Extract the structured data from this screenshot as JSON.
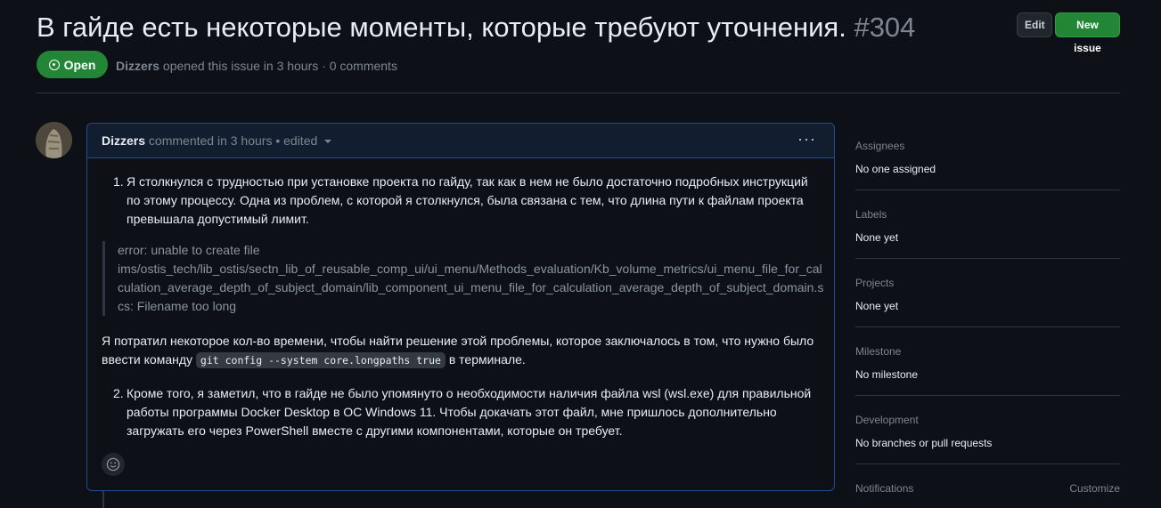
{
  "issue": {
    "title": "В гайде есть некоторые моменты, которые требуют уточнения.",
    "number": "#304",
    "state": "Open",
    "author": "Dizzers",
    "meta_text": "opened this issue in 3 hours · 0 comments"
  },
  "header_buttons": {
    "edit": "Edit",
    "new_issue": "New issue"
  },
  "comment": {
    "author": "Dizzers",
    "meta": "commented in 3 hours • edited",
    "item1_num": "1.",
    "item1": "Я столкнулся с трудностью при установке проекта по гайду, так как в нем не было достаточно подробных инструкций по этому процессу. Одна из проблем, с которой я столкнулся, была связана с тем, что длина пути к файлам проекта превышала допустимый лимит.",
    "quote_line1": "error: unable to create file",
    "quote_line2": "ims/ostis_tech/lib_ostis/sectn_lib_of_reusable_comp_ui/ui_menu/Methods_evaluation/Kb_volume_metrics/ui_menu_file_for_cal",
    "quote_line3": "culation_average_depth_of_subject_domain/lib_component_ui_menu_file_for_calculation_average_depth_of_subject_domain.s",
    "quote_line4": "cs: Filename too long",
    "para_before": "Я потратил некоторое кол-во времени, чтобы найти решение этой проблемы, которое заключалось в том, что нужно было ввести команду",
    "code": "git config --system core.longpaths true",
    "para_after": "в терминале.",
    "item2_num": "2.",
    "item2": "Кроме того, я заметил, что в гайде не было упомянуто о необходимости наличия файла wsl (wsl.exe) для правильной работы программы Docker Desktop в ОС Windows 11. Чтобы докачать этот файл, мне пришлось дополнительно загружать его через PowerShell вместе с другими компонентами, которые он требует."
  },
  "sidebar": {
    "assignees_label": "Assignees",
    "assignees_value": "No one assigned",
    "labels_label": "Labels",
    "labels_value": "None yet",
    "projects_label": "Projects",
    "projects_value": "None yet",
    "milestone_label": "Milestone",
    "milestone_value": "No milestone",
    "development_label": "Development",
    "development_value": "No branches or pull requests",
    "notifications_label": "Notifications",
    "customize": "Customize"
  },
  "colors": {
    "accent_green": "#238636",
    "comment_border": "#1f4f8f",
    "background": "#0d1117"
  },
  "icons": {
    "state": "issue-opened-icon",
    "reaction": "smiley-icon",
    "menu": "kebab-horizontal-icon"
  }
}
